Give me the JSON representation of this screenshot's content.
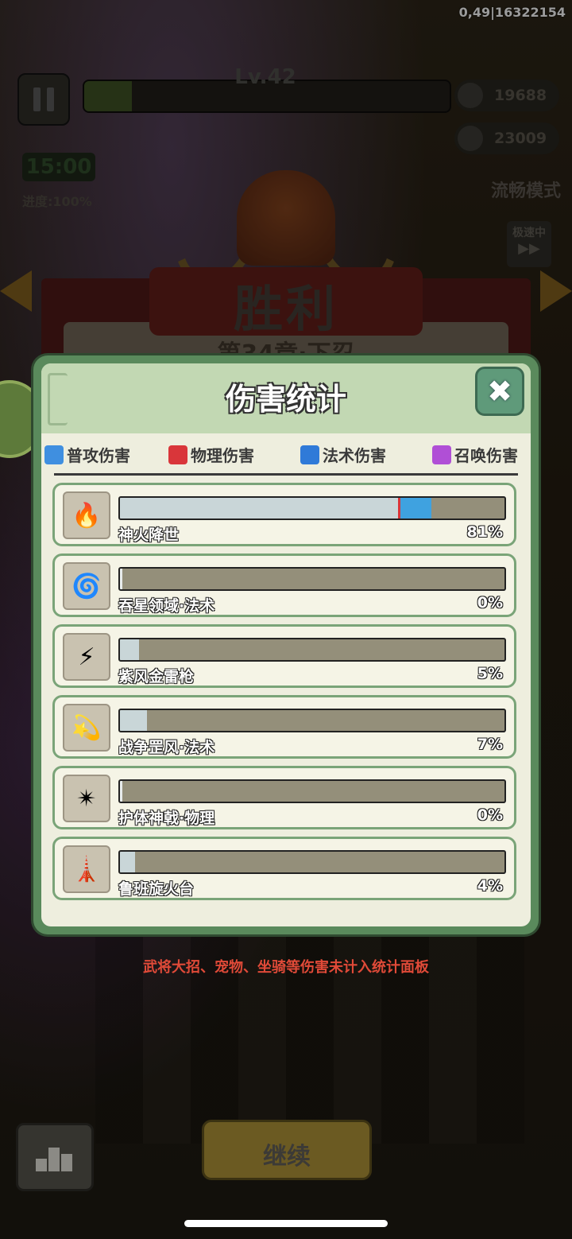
{
  "hud": {
    "session_id": "0,49|16322154",
    "level": "Lv.42",
    "level_progress": 0.13,
    "coins": "19688",
    "kills": "23009",
    "timer": "15:00",
    "progress": "进度:100%",
    "mode": "流畅模式",
    "speed": "极速中"
  },
  "result": {
    "title": "胜利",
    "chapter": "第34章·下忍"
  },
  "panel": {
    "title": "伤害统计",
    "tabs": [
      {
        "label": "普攻伤害",
        "icon": "sword-icon",
        "color": "#3f8fe0"
      },
      {
        "label": "物理伤害",
        "icon": "fist-icon",
        "color": "#d9363a"
      },
      {
        "label": "法术伤害",
        "icon": "flame-icon",
        "color": "#2f7ad8"
      },
      {
        "label": "召唤伤害",
        "icon": "paw-icon",
        "color": "#b04fd6"
      }
    ],
    "skills": [
      {
        "name": "神火降世",
        "percent": "81%",
        "value": 0.81,
        "icon": "divine-fire-icon",
        "glyph": "🔥"
      },
      {
        "name": "吞星领域·法术",
        "percent": "0%",
        "value": 0.0,
        "icon": "vortex-icon",
        "glyph": "🌀"
      },
      {
        "name": "紫风金雷枪",
        "percent": "5%",
        "value": 0.05,
        "icon": "thunder-spear-icon",
        "glyph": "⚡"
      },
      {
        "name": "战争罡风·法术",
        "percent": "7%",
        "value": 0.07,
        "icon": "war-wind-icon",
        "glyph": "💫"
      },
      {
        "name": "护体神戟·物理",
        "percent": "0%",
        "value": 0.0,
        "icon": "guardian-halberd-icon",
        "glyph": "✴"
      },
      {
        "name": "鲁班旋火台",
        "percent": "4%",
        "value": 0.04,
        "icon": "fire-tower-icon",
        "glyph": "🗼"
      }
    ]
  },
  "note": "武将大招、宠物、坐骑等伤害未计入统计面板",
  "continue_label": "继续",
  "colors": {
    "accent": "#3fa2e0",
    "note": "#e04a38"
  }
}
